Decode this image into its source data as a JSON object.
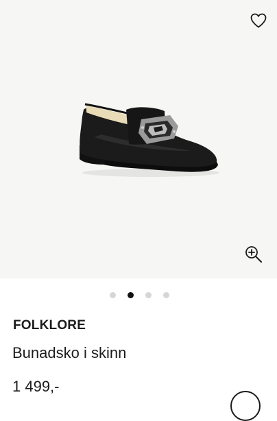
{
  "product": {
    "brand": "FOLKLORE",
    "name": "Bunadsko i skinn",
    "price": "1 499,-"
  },
  "gallery": {
    "image_subject": "black leather loafer with silver buckle",
    "dot_count": 4,
    "active_index": 1
  },
  "icons": {
    "wishlist": "heart-outline-icon",
    "zoom": "zoom-in-icon"
  },
  "colors": {
    "image_background": "#f6f6f4",
    "text": "#1c1c1c",
    "dot_active": "#111111",
    "dot_inactive": "#d6d6d6"
  }
}
